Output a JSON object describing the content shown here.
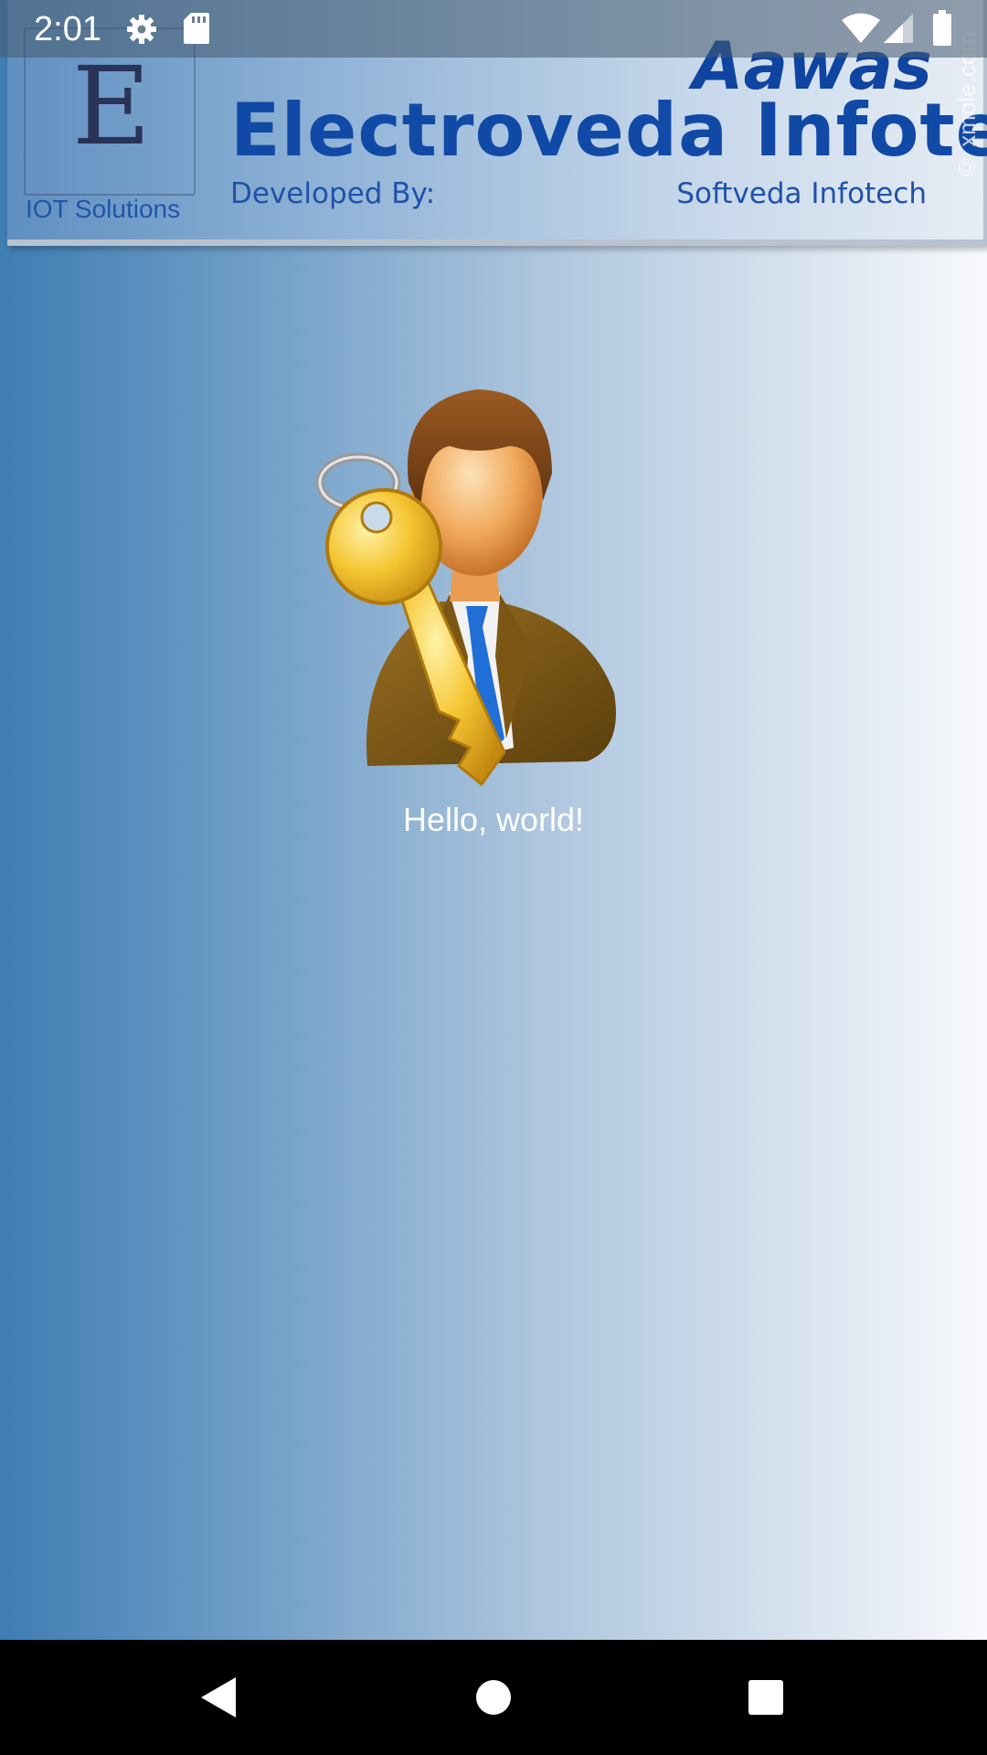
{
  "status_bar": {
    "time": "2:01",
    "icons": [
      "settings-icon",
      "sdcard-icon",
      "wifi-icon",
      "signal-icon",
      "battery-icon"
    ]
  },
  "banner": {
    "logo_tagline": "IOT Solutions",
    "app_name": "Aawas",
    "company_name": "Electroveda Infotech",
    "developed_by_label": "Developed By:",
    "developer_name": "Softveda Infotech",
    "watermark": "© xmole.com"
  },
  "main": {
    "illustration_icon": "user-with-key-icon",
    "greeting": "Hello, world!"
  },
  "nav_bar": {
    "icons": [
      "back-icon",
      "home-icon",
      "recents-icon"
    ]
  },
  "colors": {
    "brand_blue": "#114aa6",
    "gradient_left": "#3f7db3",
    "gradient_right": "#f8f9fc",
    "nav_bar": "#000000"
  }
}
